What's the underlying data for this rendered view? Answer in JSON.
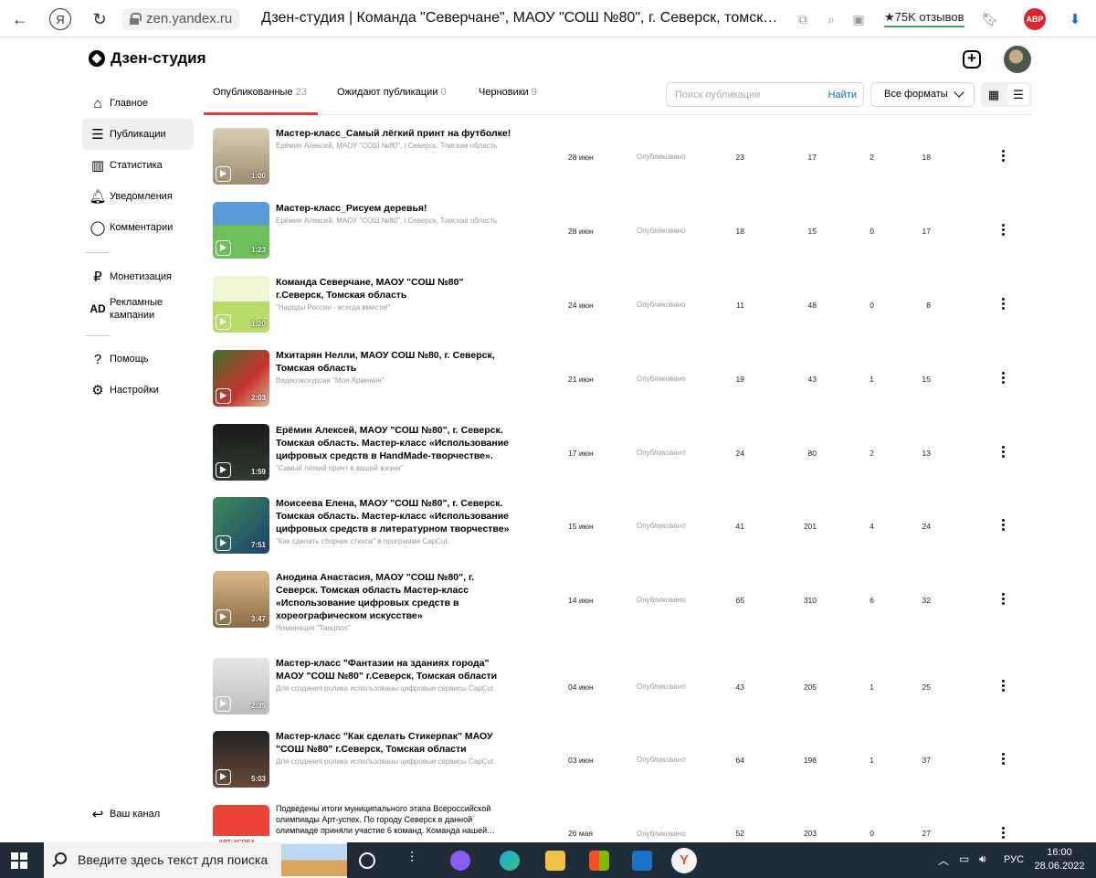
{
  "browser": {
    "url": "zen.yandex.ru",
    "title": "Дзен-студия | Команда \"Северчане\", МАОУ \"СОШ №80\", г. Северск, томск…",
    "reviews": "75K отзывов",
    "abp": "ABP"
  },
  "app": {
    "logo": "Дзен-студия"
  },
  "sidebar": {
    "items": [
      {
        "label": "Главное",
        "icon": "home-icon"
      },
      {
        "label": "Публикации",
        "icon": "publications-icon"
      },
      {
        "label": "Статистика",
        "icon": "stats-icon"
      },
      {
        "label": "Уведомления",
        "icon": "bell-icon"
      },
      {
        "label": "Комментарии",
        "icon": "comment-icon"
      },
      {
        "label": "Монетизация",
        "icon": "ruble-icon"
      },
      {
        "label": "Рекламные кампании",
        "icon": "ad-icon",
        "icon_text": "AD"
      },
      {
        "label": "Помощь",
        "icon": "help-icon"
      },
      {
        "label": "Настройки",
        "icon": "gear-icon"
      },
      {
        "label": "Ваш канал",
        "icon": "back-arrow-icon"
      }
    ]
  },
  "tabs": [
    {
      "label": "Опубликованные",
      "count": "23"
    },
    {
      "label": "Ожидают публикации",
      "count": "0"
    },
    {
      "label": "Черновики",
      "count": "9"
    }
  ],
  "search": {
    "placeholder": "Поиск публикации",
    "button": "Найти"
  },
  "filter": {
    "label": "Все форматы"
  },
  "publications": [
    {
      "title": "Мастер-класс_Самый лёгкий принт на футболке!",
      "desc": "Ерёмин Алексей, МАОУ \"СОШ №80\", г.Северск, Томская область",
      "duration": "1:00",
      "date": "28 июн",
      "status": "Опубликовано",
      "n1": "23",
      "n2": "17",
      "n3": "2",
      "n4": "18"
    },
    {
      "title": "Мастер-класс_Рисуем деревья!",
      "desc": "Ерёмин Алексей, МАОУ \"СОШ №80\", г.Северск, Томская область",
      "duration": "1:23",
      "date": "28 июн",
      "status": "Опубликовано",
      "n1": "18",
      "n2": "15",
      "n3": "0",
      "n4": "17"
    },
    {
      "title": "Команда Северчане, МАОУ \"СОШ №80\" г.Северск, Томская область",
      "desc": "\"Народы России - всегда вместе!\"",
      "duration": "1:20",
      "date": "24 июн",
      "status": "Опубликовано",
      "n1": "11",
      "n2": "48",
      "n3": "0",
      "n4": "8"
    },
    {
      "title": "Мхитарян Нелли, МАОУ СОШ №80, г. Северск, Томская область",
      "desc": "Видеоэкскурсия \"Моя Армения\"",
      "duration": "2:03",
      "date": "21 июн",
      "status": "Опубликовано",
      "n1": "19",
      "n2": "43",
      "n3": "1",
      "n4": "15"
    },
    {
      "title": "Ерёмин Алексей, МАОУ \"СОШ №80\", г. Северск. Томская область. Мастер-класс «Использование цифровых средств в HandMade-творчестве».",
      "desc": "\"Самый лёгкий принт в вашей жизни\"",
      "duration": "1:59",
      "date": "17 июн",
      "status": "Опубликовано",
      "n1": "24",
      "n2": "80",
      "n3": "2",
      "n4": "13"
    },
    {
      "title": "Моисеева Елена, МАОУ \"СОШ №80\", г. Северск. Томская область. Мастер-класс «Использование цифровых средств в литературном творчестве»",
      "desc": "\"Как сделать сборник стихов\" в программе CapCut.",
      "duration": "7:51",
      "date": "15 июн",
      "status": "Опубликовано",
      "n1": "41",
      "n2": "201",
      "n3": "4",
      "n4": "24"
    },
    {
      "title": "Анодина Анастасия, МАОУ \"СОШ №80\", г. Северск. Томская область Мастер-класс «Использование цифровых средств в хореографическом искусстве»",
      "desc": "Номинация \"Танцпол\"",
      "duration": "3:47",
      "date": "14 июн",
      "status": "Опубликовано",
      "n1": "65",
      "n2": "310",
      "n3": "6",
      "n4": "32"
    },
    {
      "title": "Мастер-класс \"Фантазии на зданиях города\" МАОУ \"СОШ №80\" г.Северск, Томская области",
      "desc": "Для создания ролика использованы цифровые сервисы CapCut.",
      "duration": "2:35",
      "date": "04 июн",
      "status": "Опубликовано",
      "n1": "43",
      "n2": "205",
      "n3": "1",
      "n4": "25"
    },
    {
      "title": "Мастер-класс \"Как сделать Стикерпак\" МАОУ \"СОШ №80\" г.Северск, Томская области",
      "desc": "Для создания ролика использованы цифровые сервисы CapCut.",
      "duration": "5:03",
      "date": "03 июн",
      "status": "Опубликовано",
      "n1": "64",
      "n2": "198",
      "n3": "1",
      "n4": "37"
    },
    {
      "title": "Подведены итоги муниципального этапа Всероссийской олимпиады Арт-успех. По городу Северск в данной олимпиаде приняли участие 6 команд. Команда нашей…",
      "desc": "",
      "duration": "",
      "thumb_text": "АРТ-УСПЕХ",
      "date": "26 мая",
      "status": "Опубликовано",
      "n1": "52",
      "n2": "203",
      "n3": "0",
      "n4": "27"
    }
  ],
  "taskbar": {
    "search_text": "Введите здесь текст для поиска",
    "lang": "РУС",
    "time": "16:00",
    "date": "28.06.2022"
  }
}
